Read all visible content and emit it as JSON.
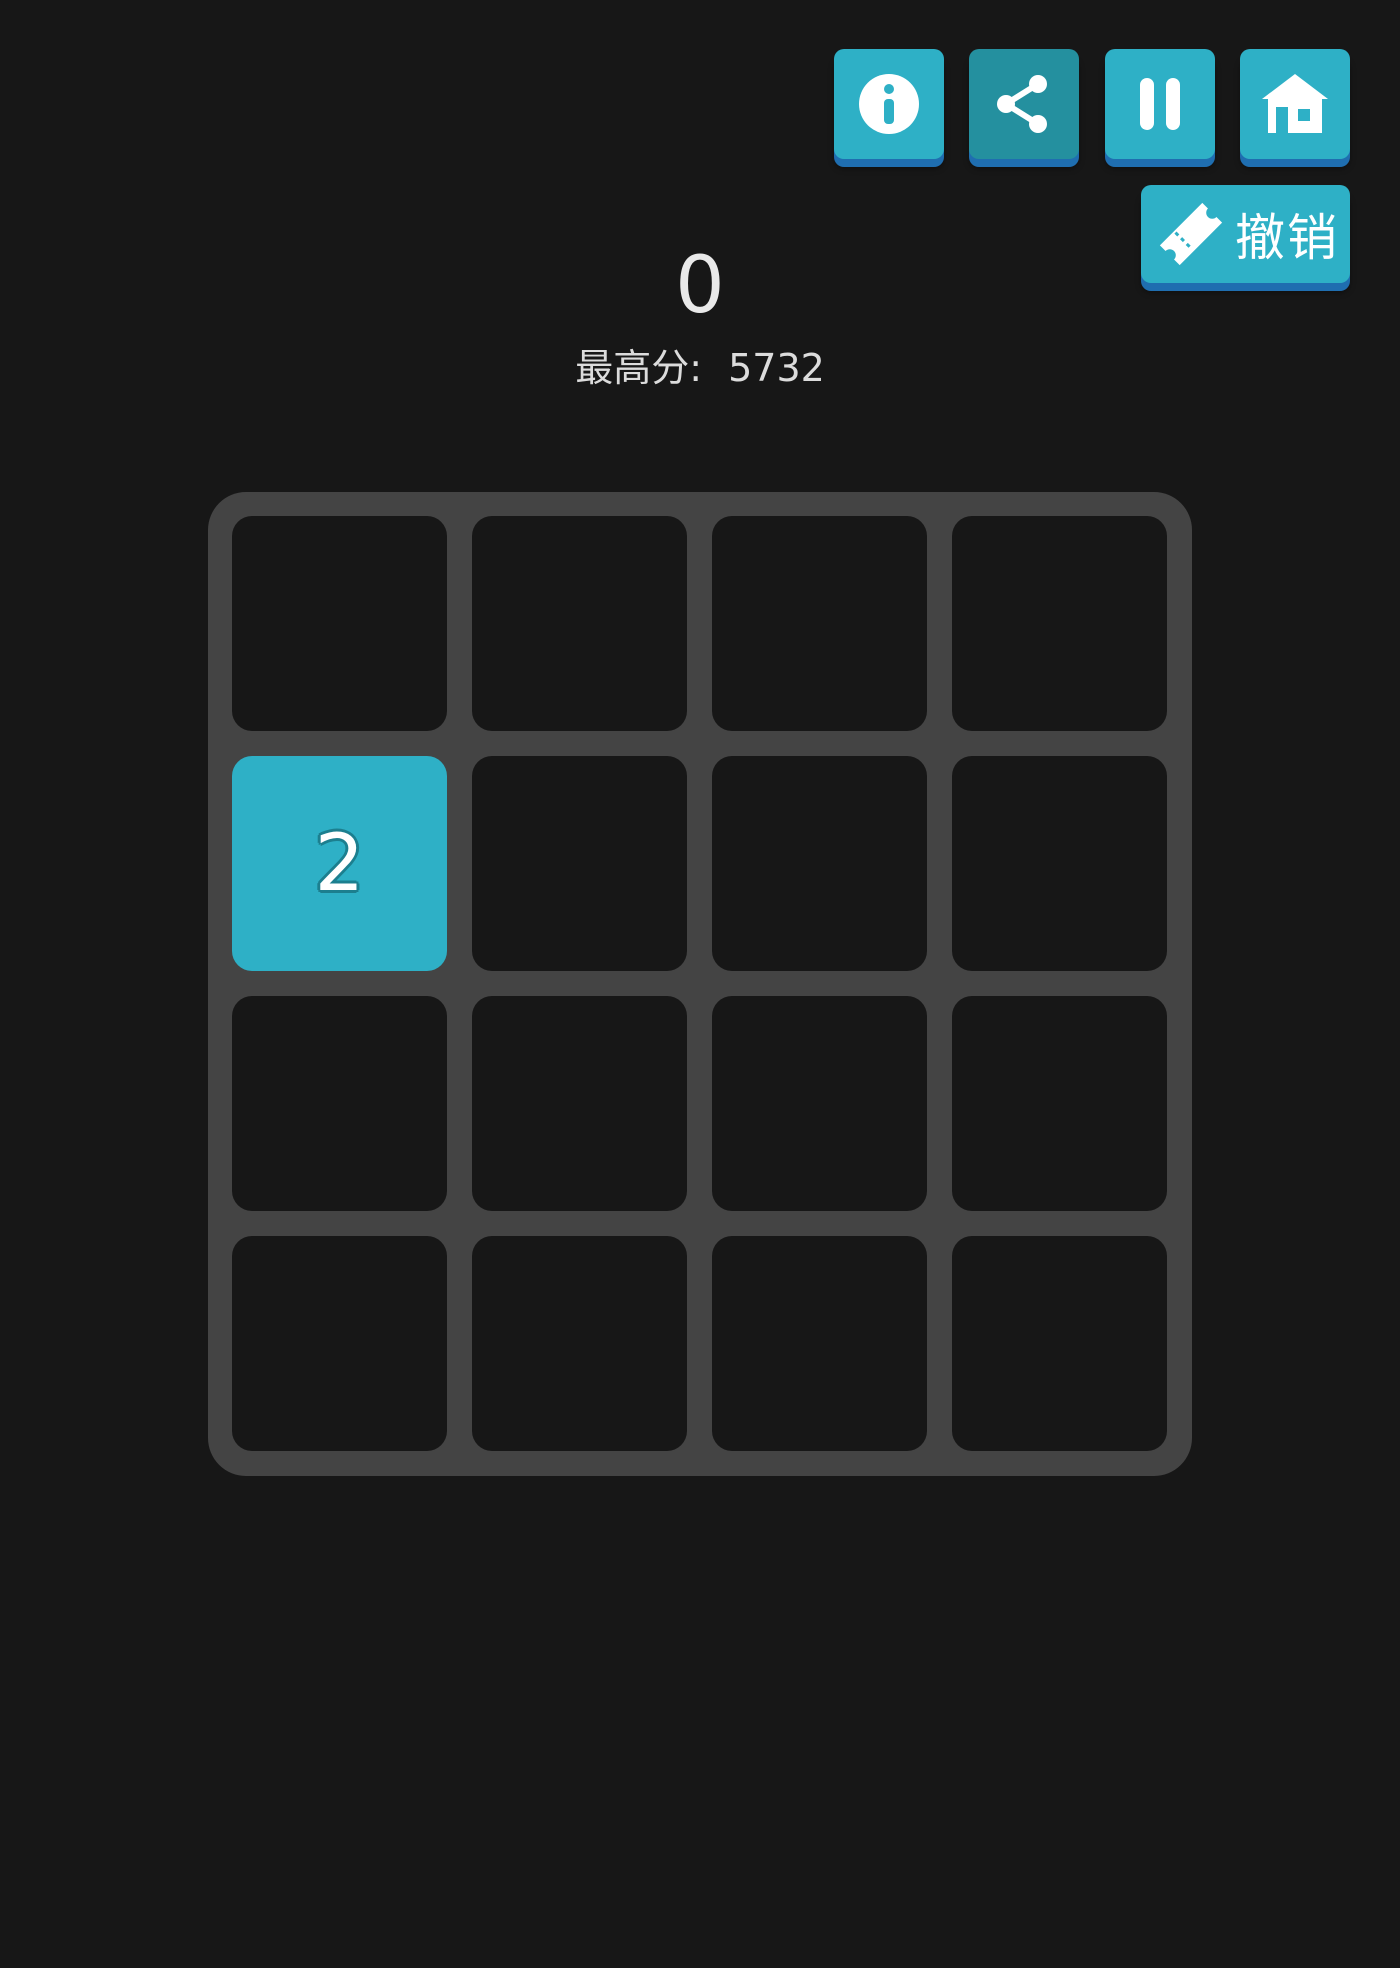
{
  "toolbar": {
    "buttons": [
      {
        "name": "info",
        "icon": "info-icon"
      },
      {
        "name": "share",
        "icon": "share-icon"
      },
      {
        "name": "pause",
        "icon": "pause-icon"
      },
      {
        "name": "home",
        "icon": "home-icon"
      }
    ],
    "undo_label": "撤销",
    "undo_icon": "ticket-icon"
  },
  "score": {
    "current": "0",
    "best_label": "最高分:",
    "best_value": "5732"
  },
  "board": {
    "size": 4,
    "rows": [
      [
        "",
        "",
        "",
        ""
      ],
      [
        "2",
        "",
        "",
        ""
      ],
      [
        "",
        "",
        "",
        ""
      ],
      [
        "",
        "",
        "",
        ""
      ]
    ]
  },
  "colors": {
    "background": "#171717",
    "board": "#444444",
    "empty_cell": "#171717",
    "accent": "#2eb0c6",
    "button_shadow": "#1f6eb0"
  }
}
